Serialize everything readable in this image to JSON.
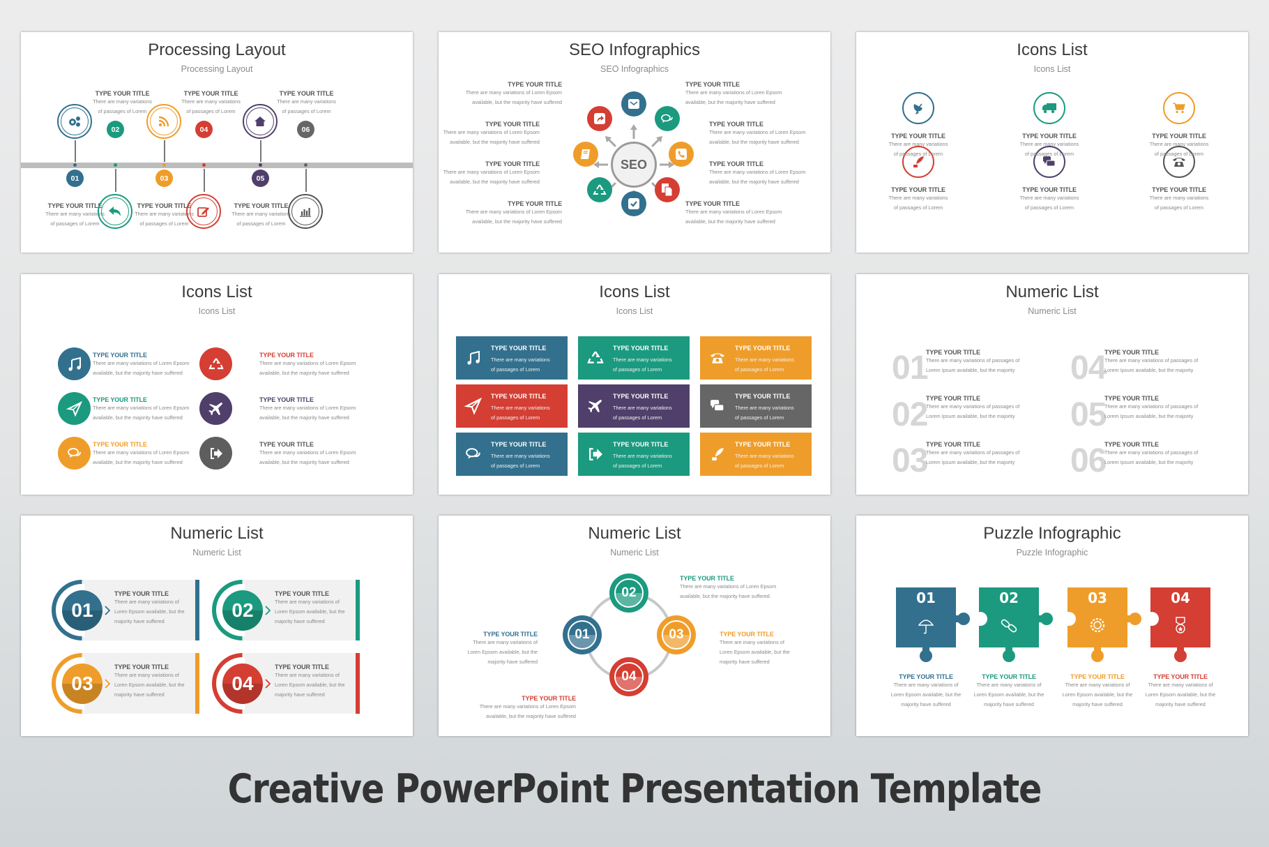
{
  "footer": {
    "title": "Creative PowerPoint Presentation Template"
  },
  "colors": {
    "blue": "#32708e",
    "teal": "#1b9a7f",
    "orange": "#ef9d2a",
    "red": "#d43e33",
    "purple": "#4f3f6a",
    "grey": "#666666",
    "timeline": "#bdbdbd",
    "card": "#f1f1f1"
  },
  "slides": [
    {
      "title": "Processing Layout",
      "subtitle": "Processing Layout",
      "steps": [
        {
          "num": "01",
          "icon": "gears-icon",
          "title": "TYPE YOUR TITLE",
          "line1": "There are many variations",
          "line2": "of passages of Lorem"
        },
        {
          "num": "02",
          "icon": "reply-icon",
          "title": "TYPE YOUR TITLE",
          "line1": "There are many variations",
          "line2": "of passages of Lorem"
        },
        {
          "num": "03",
          "icon": "rss-icon",
          "title": "TYPE YOUR TITLE",
          "line1": "There are many variations",
          "line2": "of passages of Lorem"
        },
        {
          "num": "04",
          "icon": "edit-icon",
          "title": "TYPE YOUR TITLE",
          "line1": "There are many variations",
          "line2": "of passages of Lorem"
        },
        {
          "num": "05",
          "icon": "home-icon",
          "title": "TYPE YOUR TITLE",
          "line1": "There are many variations",
          "line2": "of passages of Lorem"
        },
        {
          "num": "06",
          "icon": "bar-chart-icon",
          "title": "TYPE YOUR TITLE",
          "line1": "There are many variations",
          "line2": "of passages of Lorem"
        }
      ]
    },
    {
      "title": "SEO Infographics",
      "subtitle": "SEO Infographics",
      "center": "SEO",
      "items": [
        {
          "title": "TYPE YOUR TITLE",
          "line1": "There are many variations of Loren Epsom",
          "line2": "available, but the majority have suffered"
        },
        {
          "title": "TYPE YOUR TITLE",
          "line1": "There are many variations of Loren Epsom",
          "line2": "available, but the majority have suffered"
        },
        {
          "title": "TYPE YOUR TITLE",
          "line1": "There are many variations of Loren Epsom",
          "line2": "available, but the majority have suffered"
        },
        {
          "title": "TYPE YOUR TITLE",
          "line1": "There are many variations of Loren Epsom",
          "line2": "available, but the majority have suffered"
        },
        {
          "title": "TYPE YOUR TITLE",
          "line1": "There are many variations of Loren Epsom",
          "line2": "available, but the majority have suffered"
        },
        {
          "title": "TYPE YOUR TITLE",
          "line1": "There are many variations of Loren Epsom",
          "line2": "available, but the majority have suffered"
        },
        {
          "title": "TYPE YOUR TITLE",
          "line1": "There are many variations of Loren Epsom",
          "line2": "available, but the majority have suffered"
        },
        {
          "title": "TYPE YOUR TITLE",
          "line1": "There are many variations of Loren Epsom",
          "line2": "available, but the majority have suffered"
        }
      ],
      "satellites": [
        "mail-icon",
        "chat-icon",
        "phone-icon",
        "document-icon",
        "check-icon",
        "recycle-icon",
        "book-icon",
        "share-icon"
      ]
    },
    {
      "title": "Icons List",
      "subtitle": "Icons List",
      "items": [
        {
          "icon": "satellite-dish-icon",
          "title": "TYPE YOUR TITLE",
          "line1": "There are many variations",
          "line2": "of passages of Lorem"
        },
        {
          "icon": "truck-icon",
          "title": "TYPE YOUR TITLE",
          "line1": "There are many variations",
          "line2": "of passages of Lorem"
        },
        {
          "icon": "cart-icon",
          "title": "TYPE YOUR TITLE",
          "line1": "There are many variations",
          "line2": "of passages of Lorem"
        },
        {
          "icon": "quill-icon",
          "title": "TYPE YOUR TITLE",
          "line1": "There are many variations",
          "line2": "of passages of Lorem"
        },
        {
          "icon": "chat-icon",
          "title": "TYPE YOUR TITLE",
          "line1": "There are many variations",
          "line2": "of passages of Lorem"
        },
        {
          "icon": "telephone-icon",
          "title": "TYPE YOUR TITLE",
          "line1": "There are many variations",
          "line2": "of passages of Lorem"
        }
      ]
    },
    {
      "title": "Icons List",
      "subtitle": "Icons List",
      "items": [
        {
          "icon": "music-icon",
          "title": "TYPE YOUR TITLE",
          "line1": "There are many variations of Loren Epsom",
          "line2": "available, but the majority have suffered"
        },
        {
          "icon": "recycle-icon",
          "title": "TYPE YOUR TITLE",
          "line1": "There are many variations of Loren Epsom",
          "line2": "available, but the majority have suffered"
        },
        {
          "icon": "paper-plane-icon",
          "title": "TYPE YOUR TITLE",
          "line1": "There are many variations of Loren Epsom",
          "line2": "available, but the majority have suffered"
        },
        {
          "icon": "airplane-icon",
          "title": "TYPE YOUR TITLE",
          "line1": "There are many variations of Loren Epsom",
          "line2": "available, but the majority have suffered"
        },
        {
          "icon": "chat-icon",
          "title": "TYPE YOUR TITLE",
          "line1": "There are many variations of Loren Epsom",
          "line2": "available, but the majority have suffered"
        },
        {
          "icon": "sign-out-icon",
          "title": "TYPE YOUR TITLE",
          "line1": "There are many variations of Loren Epsom",
          "line2": "available, but the majority have suffered"
        }
      ]
    },
    {
      "title": "Icons List",
      "subtitle": "Icons List",
      "tiles": [
        {
          "icon": "music-icon",
          "title": "TYPE YOUR TITLE",
          "line1": "There are many variations",
          "line2": "of passages of Lorem"
        },
        {
          "icon": "recycle-icon",
          "title": "TYPE YOUR TITLE",
          "line1": "There are many variations",
          "line2": "of passages of Lorem"
        },
        {
          "icon": "telephone-icon",
          "title": "TYPE YOUR TITLE",
          "line1": "There are many variations",
          "line2": "of passages of Lorem"
        },
        {
          "icon": "paper-plane-icon",
          "title": "TYPE YOUR TITLE",
          "line1": "There are many variations",
          "line2": "of passages of Lorem"
        },
        {
          "icon": "airplane-icon",
          "title": "TYPE YOUR TITLE",
          "line1": "There are many variations",
          "line2": "of passages of Lorem"
        },
        {
          "icon": "chat-icon",
          "title": "TYPE YOUR TITLE",
          "line1": "There are many variations",
          "line2": "of passages of Lorem"
        },
        {
          "icon": "chat-outline-icon",
          "title": "TYPE YOUR TITLE",
          "line1": "There are many variations",
          "line2": "of passages of Lorem"
        },
        {
          "icon": "sign-out-icon",
          "title": "TYPE YOUR TITLE",
          "line1": "There are many variations",
          "line2": "of passages of Lorem"
        },
        {
          "icon": "quill-icon",
          "title": "TYPE YOUR TITLE",
          "line1": "There are many variations",
          "line2": "of passages of Lorem"
        }
      ]
    },
    {
      "title": "Numeric List",
      "subtitle": "Numeric List",
      "items": [
        {
          "num": "01",
          "title": "TYPE YOUR TITLE",
          "line1": "There are many variations of passages of",
          "line2": "Lorem Ipsum available, but the majority"
        },
        {
          "num": "02",
          "title": "TYPE YOUR TITLE",
          "line1": "There are many variations of passages of",
          "line2": "Lorem Ipsum available, but the majority"
        },
        {
          "num": "03",
          "title": "TYPE YOUR TITLE",
          "line1": "There are many variations of passages of",
          "line2": "Lorem Ipsum available, but the majority"
        },
        {
          "num": "04",
          "title": "TYPE YOUR TITLE",
          "line1": "There are many variations of passages of",
          "line2": "Lorem Ipsum available, but the majority"
        },
        {
          "num": "05",
          "title": "TYPE YOUR TITLE",
          "line1": "There are many variations of passages of",
          "line2": "Lorem Ipsum available, but the majority"
        },
        {
          "num": "06",
          "title": "TYPE YOUR TITLE",
          "line1": "There are many variations of passages of",
          "line2": "Lorem Ipsum available, but the majority"
        }
      ]
    },
    {
      "title": "Numeric List",
      "subtitle": "Numeric List",
      "items": [
        {
          "num": "01",
          "title": "TYPE YOUR TITLE",
          "line1": "There are many variations of",
          "line2": "Loren Epsom available, but the",
          "line3": "majority have suffered"
        },
        {
          "num": "02",
          "title": "TYPE YOUR TITLE",
          "line1": "There are many variations of",
          "line2": "Loren Epsom available, but the",
          "line3": "majority have suffered"
        },
        {
          "num": "03",
          "title": "TYPE YOUR TITLE",
          "line1": "There are many variations of",
          "line2": "Loren Epsom available, but the",
          "line3": "majority have suffered"
        },
        {
          "num": "04",
          "title": "TYPE YOUR TITLE",
          "line1": "There are many variations of",
          "line2": "Loren Epsom available, but the",
          "line3": "majority have suffered"
        }
      ]
    },
    {
      "title": "Numeric List",
      "subtitle": "Numeric List",
      "items": [
        {
          "num": "01",
          "title": "TYPE YOUR TITLE",
          "line1": "There are many variations of",
          "line2": "Loren Epsom available, but the",
          "line3": "majority have suffered"
        },
        {
          "num": "02",
          "title": "TYPE YOUR TITLE",
          "line1": "There are many variations of Loren Epsom",
          "line2": "available, but the majority have suffered"
        },
        {
          "num": "03",
          "title": "TYPE YOUR TITLE",
          "line1": "There are many variations of",
          "line2": "Loren Epsom available, but the",
          "line3": "majority have suffered"
        },
        {
          "num": "04",
          "title": "TYPE YOUR TITLE",
          "line1": "There are many variations of Loren Epsom",
          "line2": "available, but the majority have suffered"
        }
      ]
    },
    {
      "title": "Puzzle Infographic",
      "subtitle": "Puzzle Infographic",
      "pieces": [
        {
          "num": "01",
          "icon": "umbrella-icon",
          "title": "TYPE YOUR TITLE",
          "line1": "There are many variations of",
          "line2": "Loren Epsom available, but the",
          "line3": "majority have suffered"
        },
        {
          "num": "02",
          "icon": "link-icon",
          "title": "TYPE YOUR TITLE",
          "line1": "There are many variations of",
          "line2": "Loren Epsom available, but the",
          "line3": "majority have suffered"
        },
        {
          "num": "03",
          "icon": "gear-icon",
          "title": "TYPE YOUR TITLE",
          "line1": "There are many variations of",
          "line2": "Loren Epsom available, but the",
          "line3": "majority have suffered"
        },
        {
          "num": "04",
          "icon": "medal-icon",
          "title": "TYPE YOUR TITLE",
          "line1": "There are many variations of",
          "line2": "Loren Epsom available, but the",
          "line3": "majority have suffered"
        }
      ]
    }
  ]
}
